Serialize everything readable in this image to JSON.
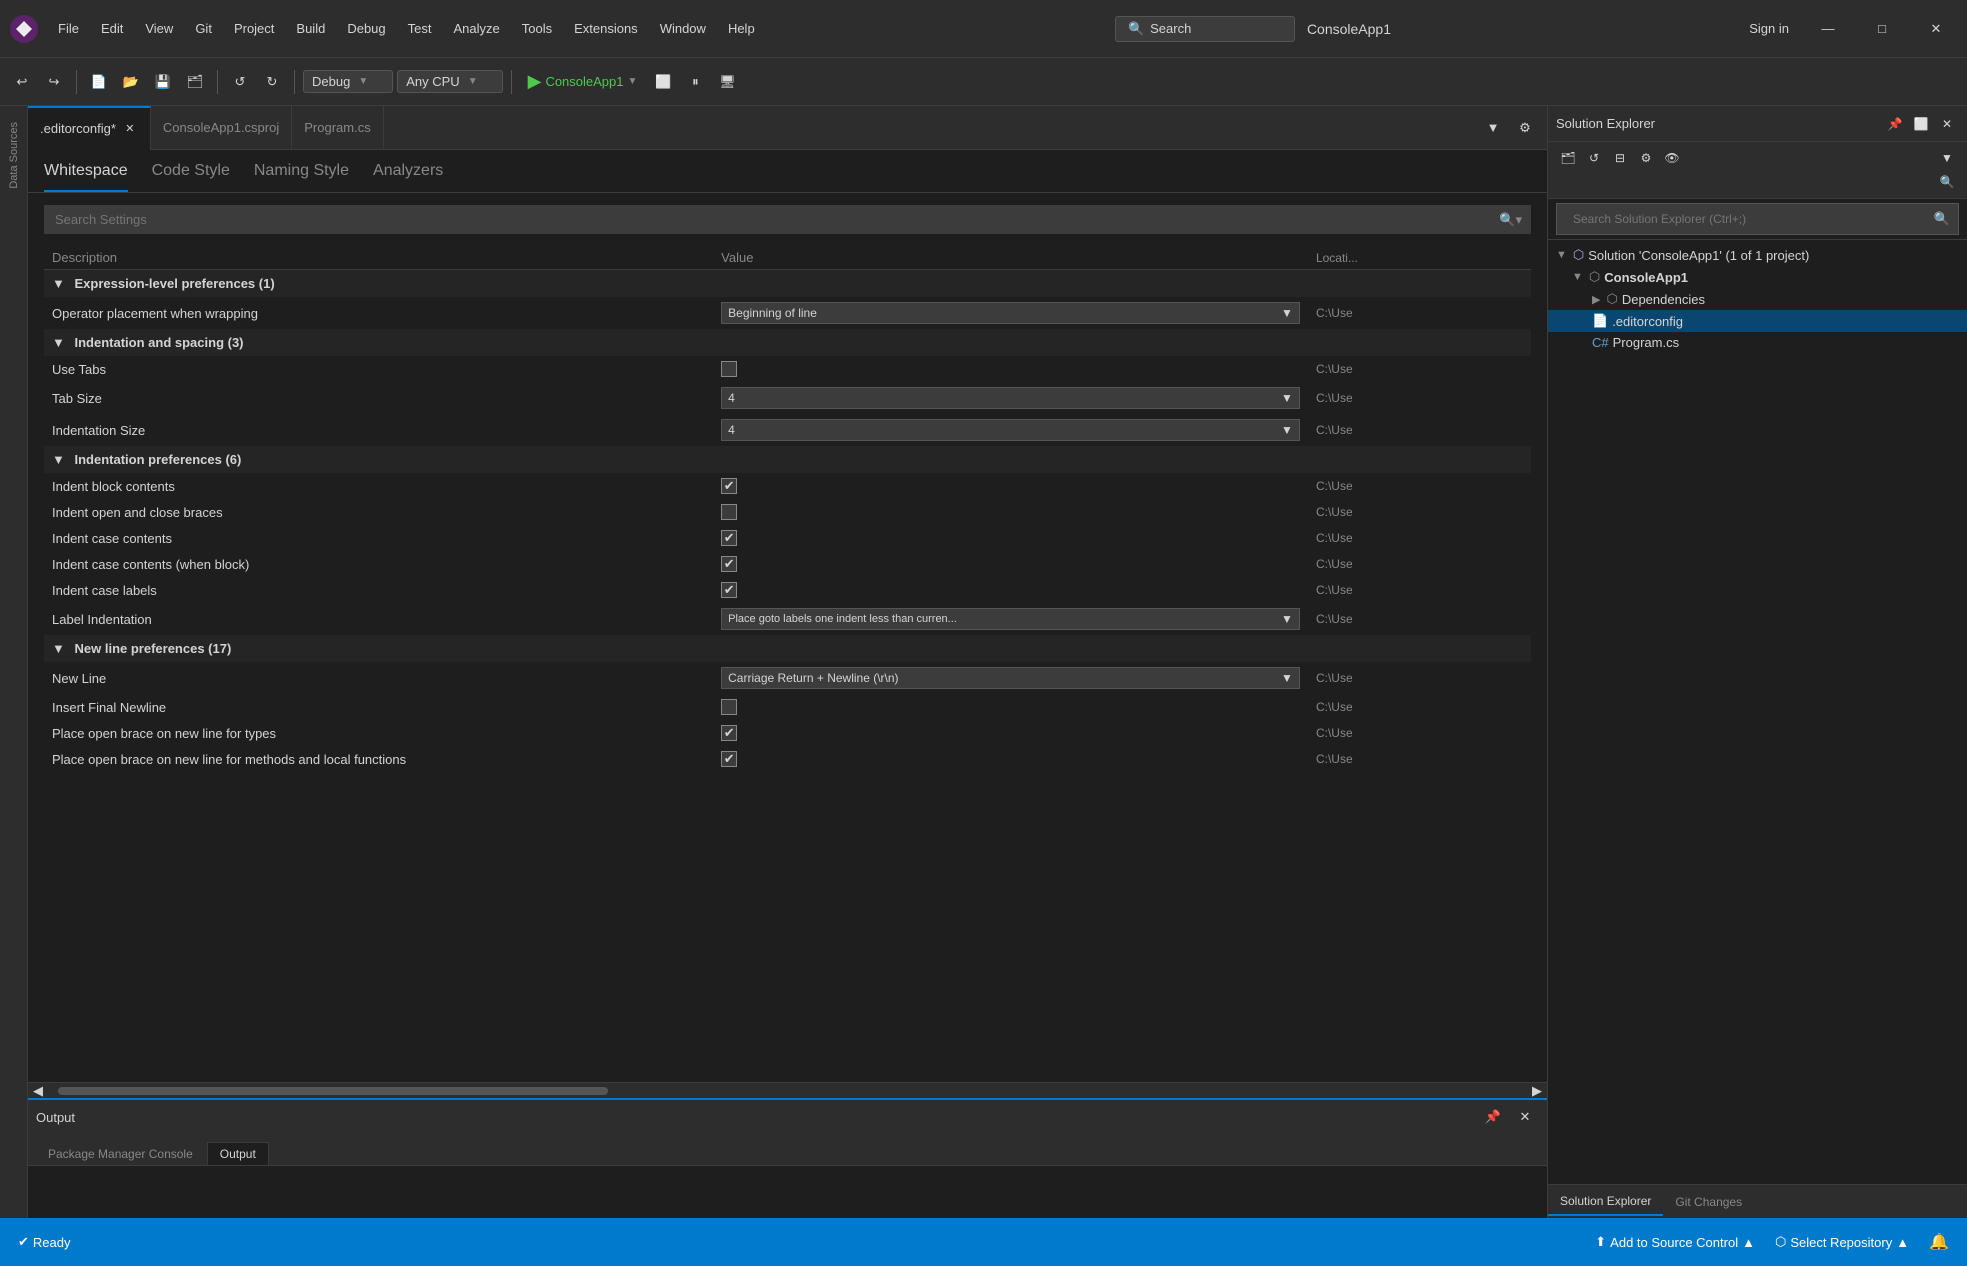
{
  "titlebar": {
    "menu": [
      "File",
      "Edit",
      "View",
      "Git",
      "Project",
      "Build",
      "Debug",
      "Test",
      "Analyze",
      "Tools",
      "Extensions",
      "Window",
      "Help"
    ],
    "search_label": "Search",
    "app_name": "ConsoleApp1",
    "sign_in": "Sign in",
    "minimize": "—",
    "maximize": "□",
    "close": "✕"
  },
  "toolbar": {
    "debug_mode": "Debug",
    "platform": "Any CPU",
    "run_label": "ConsoleApp1",
    "separator": "|"
  },
  "tabs": [
    {
      "label": ".editorconfig*",
      "active": true,
      "modified": true
    },
    {
      "label": "ConsoleApp1.csproj",
      "active": false
    },
    {
      "label": "Program.cs",
      "active": false
    }
  ],
  "content_tabs": [
    {
      "label": "Whitespace",
      "active": true
    },
    {
      "label": "Code Style",
      "active": false
    },
    {
      "label": "Naming Style",
      "active": false
    },
    {
      "label": "Analyzers",
      "active": false
    }
  ],
  "search_settings": {
    "placeholder": "Search Settings",
    "button_label": "🔍"
  },
  "table_headers": {
    "description": "Description",
    "value": "Value",
    "location": "Locati..."
  },
  "settings_sections": [
    {
      "id": "expression-level",
      "header": "Expression-level preferences  (1)",
      "rows": [
        {
          "desc": "Operator placement when wrapping",
          "type": "dropdown",
          "value": "Beginning of line",
          "location": "C:\\Use"
        }
      ]
    },
    {
      "id": "indentation-spacing",
      "header": "Indentation and spacing  (3)",
      "rows": [
        {
          "desc": "Use Tabs",
          "type": "checkbox",
          "checked": false,
          "location": "C:\\Use"
        },
        {
          "desc": "Tab Size",
          "type": "dropdown",
          "value": "4",
          "location": "C:\\Use"
        },
        {
          "desc": "Indentation Size",
          "type": "dropdown",
          "value": "4",
          "location": "C:\\Use"
        }
      ]
    },
    {
      "id": "indentation-preferences",
      "header": "Indentation preferences  (6)",
      "rows": [
        {
          "desc": "Indent block contents",
          "type": "checkbox",
          "checked": true,
          "location": "C:\\Use"
        },
        {
          "desc": "Indent open and close braces",
          "type": "checkbox",
          "checked": false,
          "location": "C:\\Use"
        },
        {
          "desc": "Indent case contents",
          "type": "checkbox",
          "checked": true,
          "location": "C:\\Use"
        },
        {
          "desc": "Indent case contents (when block)",
          "type": "checkbox",
          "checked": true,
          "location": "C:\\Use"
        },
        {
          "desc": "Indent case labels",
          "type": "checkbox",
          "checked": true,
          "location": "C:\\Use"
        },
        {
          "desc": "Label Indentation",
          "type": "dropdown",
          "value": "Place goto labels one indent less than curren...",
          "location": "C:\\Use"
        }
      ]
    },
    {
      "id": "new-line-preferences",
      "header": "New line preferences  (17)",
      "rows": [
        {
          "desc": "New Line",
          "type": "dropdown",
          "value": "Carriage Return + Newline (\\r\\n)",
          "location": "C:\\Use"
        },
        {
          "desc": "Insert Final Newline",
          "type": "checkbox",
          "checked": false,
          "location": "C:\\Use"
        },
        {
          "desc": "Place open brace on new line for types",
          "type": "checkbox",
          "checked": true,
          "location": "C:\\Use"
        },
        {
          "desc": "Place open brace on new line for methods and local functions",
          "type": "checkbox",
          "checked": true,
          "location": "C:\\Use"
        }
      ]
    }
  ],
  "output_panel": {
    "title": "Output",
    "tabs": [
      "Package Manager Console",
      "Output"
    ]
  },
  "solution_explorer": {
    "title": "Solution Explorer",
    "search_placeholder": "Search Solution Explorer (Ctrl+;)",
    "tree": [
      {
        "label": "Solution 'ConsoleApp1' (1 of 1 project)",
        "level": 0,
        "icon": "solution",
        "expanded": true
      },
      {
        "label": "ConsoleApp1",
        "level": 1,
        "icon": "project",
        "expanded": true,
        "selected": false
      },
      {
        "label": "Dependencies",
        "level": 2,
        "icon": "dependencies",
        "expanded": false
      },
      {
        "label": ".editorconfig",
        "level": 2,
        "icon": "editorconfig",
        "selected": true
      },
      {
        "label": "Program.cs",
        "level": 2,
        "icon": "cs"
      }
    ],
    "bottom_tabs": [
      "Solution Explorer",
      "Git Changes"
    ]
  },
  "status_bar": {
    "ready": "Ready",
    "source_control": "Add to Source Control",
    "select_repo": "Select Repository",
    "bell_icon": "🔔"
  }
}
